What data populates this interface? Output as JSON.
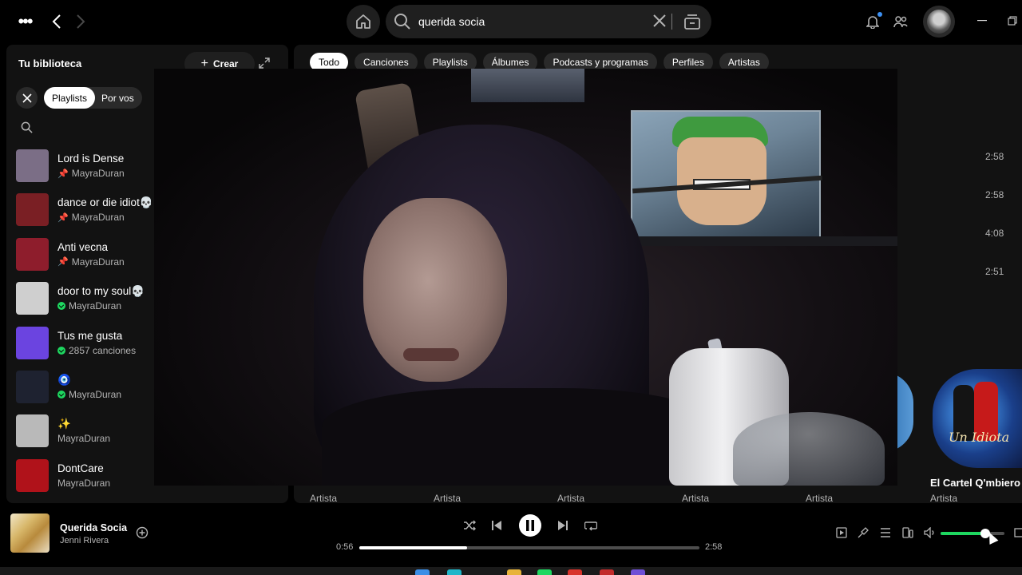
{
  "header": {
    "search_value": "querida socia",
    "notification_dot_color": "#3d91f4"
  },
  "library": {
    "title": "Tu biblioteca",
    "create_label": "Crear",
    "filter_active": "Playlists",
    "filter_other": "Por vos",
    "items": [
      {
        "name": "Lord is Dense",
        "subtitle": "MayraDuran",
        "badge": "pin",
        "thumb": "#7b6e86"
      },
      {
        "name": "dance or die idiot💀",
        "subtitle": "MayraDuran",
        "badge": "pin",
        "thumb": "#7a1f24"
      },
      {
        "name": "Anti vecna",
        "subtitle": "MayraDuran",
        "badge": "pin",
        "thumb": "#8e1d2c"
      },
      {
        "name": "door to my soul💀",
        "subtitle": "MayraDuran",
        "badge": "download",
        "thumb": "#cfcfcf"
      },
      {
        "name": "Tus me gusta",
        "subtitle": "2857 canciones",
        "badge": "download",
        "thumb": "#6b44e0"
      },
      {
        "name": "🧿",
        "subtitle": "MayraDuran",
        "badge": "download",
        "thumb": "#1e2230"
      },
      {
        "name": "✨",
        "subtitle": "MayraDuran",
        "badge": "none",
        "thumb": "#b9b9b9"
      },
      {
        "name": "DontCare",
        "subtitle": "MayraDuran",
        "badge": "none",
        "thumb": "#b0121a"
      }
    ]
  },
  "main": {
    "tabs": [
      "Todo",
      "Canciones",
      "Playlists",
      "Álbumes",
      "Podcasts y programas",
      "Perfiles",
      "Artistas"
    ],
    "active_tab": "Todo",
    "durations": [
      "2:58",
      "2:58",
      "4:08",
      "2:51"
    ],
    "artist_labels": [
      "Artista",
      "Artista",
      "Artista",
      "Artista",
      "Artista",
      "Artista"
    ],
    "featured_artist": "El Cartel Q'mbiero",
    "featured_artist_art_text": "Un Idiota"
  },
  "player": {
    "title": "Querida Socia",
    "artist": "Jenni Rivera",
    "time_current": "0:56",
    "time_total": "2:58",
    "progress": 0.317,
    "volume": 0.7,
    "accent": "#1ed760"
  }
}
